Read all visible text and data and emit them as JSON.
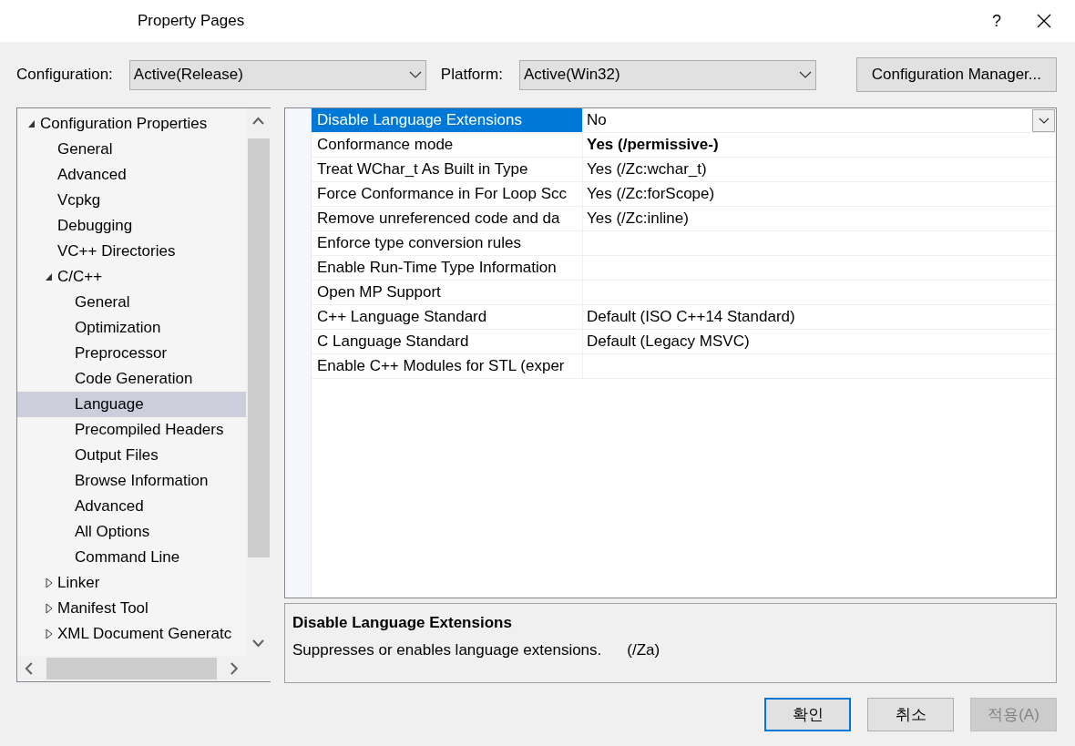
{
  "window": {
    "title": "Property Pages",
    "help": "?"
  },
  "configuration": {
    "label": "Configuration:",
    "value": "Active(Release)"
  },
  "platform": {
    "label": "Platform:",
    "value": "Active(Win32)"
  },
  "configuration_manager": "Configuration Manager...",
  "tree": [
    {
      "label": "Configuration Properties",
      "expanded": true,
      "selected": false,
      "children": [
        {
          "label": "General",
          "selected": false
        },
        {
          "label": "Advanced",
          "selected": false
        },
        {
          "label": "Vcpkg",
          "selected": false
        },
        {
          "label": "Debugging",
          "selected": false
        },
        {
          "label": "VC++ Directories",
          "selected": false
        },
        {
          "label": "C/C++",
          "expanded": true,
          "selected": false,
          "children": [
            {
              "label": "General",
              "selected": false
            },
            {
              "label": "Optimization",
              "selected": false
            },
            {
              "label": "Preprocessor",
              "selected": false
            },
            {
              "label": "Code Generation",
              "selected": false
            },
            {
              "label": "Language",
              "selected": true
            },
            {
              "label": "Precompiled Headers",
              "selected": false
            },
            {
              "label": "Output Files",
              "selected": false
            },
            {
              "label": "Browse Information",
              "selected": false
            },
            {
              "label": "Advanced",
              "selected": false
            },
            {
              "label": "All Options",
              "selected": false
            },
            {
              "label": "Command Line",
              "selected": false
            }
          ]
        },
        {
          "label": "Linker",
          "expanded": false,
          "selected": false
        },
        {
          "label": "Manifest Tool",
          "expanded": false,
          "selected": false
        },
        {
          "label": "XML Document Generatc",
          "expanded": false,
          "selected": false
        }
      ]
    }
  ],
  "properties": [
    {
      "name": "Disable Language Extensions",
      "value": "No",
      "bold": false,
      "selected": true
    },
    {
      "name": "Conformance mode",
      "value": "Yes (/permissive-)",
      "bold": true,
      "selected": false
    },
    {
      "name": "Treat WChar_t As Built in Type",
      "value": "Yes (/Zc:wchar_t)",
      "bold": false,
      "selected": false
    },
    {
      "name": "Force Conformance in For Loop Scc",
      "value": "Yes (/Zc:forScope)",
      "bold": false,
      "selected": false
    },
    {
      "name": "Remove unreferenced code and da",
      "value": "Yes (/Zc:inline)",
      "bold": false,
      "selected": false
    },
    {
      "name": "Enforce type conversion rules",
      "selected": false
    },
    {
      "name": "Enable Run-Time Type Information",
      "selected": false
    },
    {
      "name": "Open MP Support",
      "selected": false
    },
    {
      "name": "C++ Language Standard",
      "value": "Default (ISO C++14 Standard)",
      "bold": false,
      "selected": false
    },
    {
      "name": "C Language Standard",
      "value": "Default (Legacy MSVC)",
      "bold": false,
      "selected": false
    },
    {
      "name": "Enable C++ Modules for STL (exper",
      "selected": false
    }
  ],
  "description": {
    "title": "Disable Language Extensions",
    "text": "Suppresses or enables language extensions.",
    "switch": "(/Za)"
  },
  "buttons": [
    {
      "label": "확인",
      "kind": "default",
      "disabled": false
    },
    {
      "label": "취소",
      "kind": "normal",
      "disabled": false
    },
    {
      "label": "적용(A)",
      "kind": "normal",
      "disabled": true
    }
  ]
}
